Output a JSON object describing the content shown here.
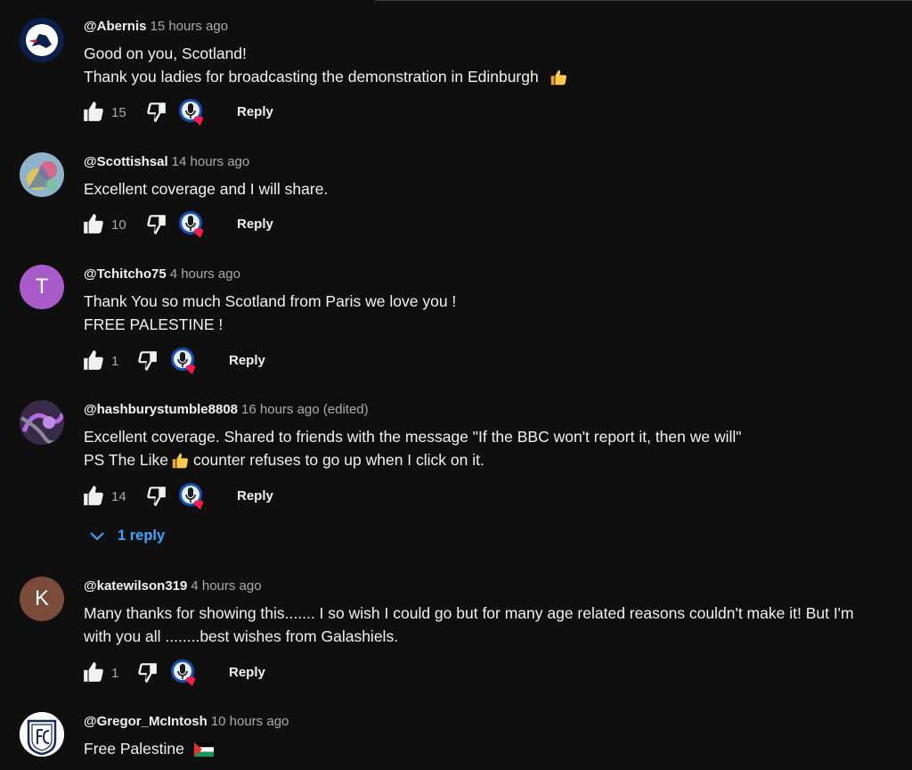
{
  "comments": [
    {
      "handle": "@Abernis",
      "time": "15 hours ago",
      "lines": [
        "Good on you, Scotland!",
        "Thank you ladies for broadcasting the demonstration in Edinburgh"
      ],
      "likes": "15",
      "reply": "Reply"
    },
    {
      "handle": "@Scottishsal",
      "time": "14 hours ago",
      "lines": [
        "Excellent coverage and I will share."
      ],
      "likes": "10",
      "reply": "Reply"
    },
    {
      "handle": "@Tchitcho75",
      "time": "4 hours ago",
      "avatar_letter": "T",
      "avatar_color": "#a95bc9",
      "lines": [
        "Thank You so much Scotland from Paris we love you !",
        "FREE PALESTINE !"
      ],
      "likes": "1",
      "reply": "Reply"
    },
    {
      "handle": "@hashburystumble8808",
      "time": "16 hours ago (edited)",
      "lines": [
        "Excellent coverage. Shared to friends with the message \"If the BBC won't report it, then we will\"",
        "PS The Like",
        "counter refuses to go up when I click on it."
      ],
      "likes": "14",
      "reply": "Reply",
      "replies_label": "1 reply"
    },
    {
      "handle": "@katewilson319",
      "time": "4 hours ago",
      "avatar_letter": "K",
      "avatar_color": "#7a4a3a",
      "lines": [
        "Many thanks for showing this....... I so wish I could go but for many age related reasons couldn't make it! But I'm",
        "with you all ........best wishes from Galashiels."
      ],
      "likes": "1",
      "reply": "Reply"
    },
    {
      "handle": "@Gregor_McIntosh",
      "time": "10 hours ago",
      "lines": [
        "Free Palestine"
      ]
    }
  ],
  "colors": {
    "background": "#0f0f0f",
    "link": "#3ea6ff",
    "secondary_text": "#aaaaaa"
  },
  "icons": [
    "thumbs-up-icon",
    "thumbs-down-icon",
    "creator-heart-icon",
    "chevron-down-icon",
    "thumbs-up-emoji",
    "palestine-flag-emoji"
  ]
}
